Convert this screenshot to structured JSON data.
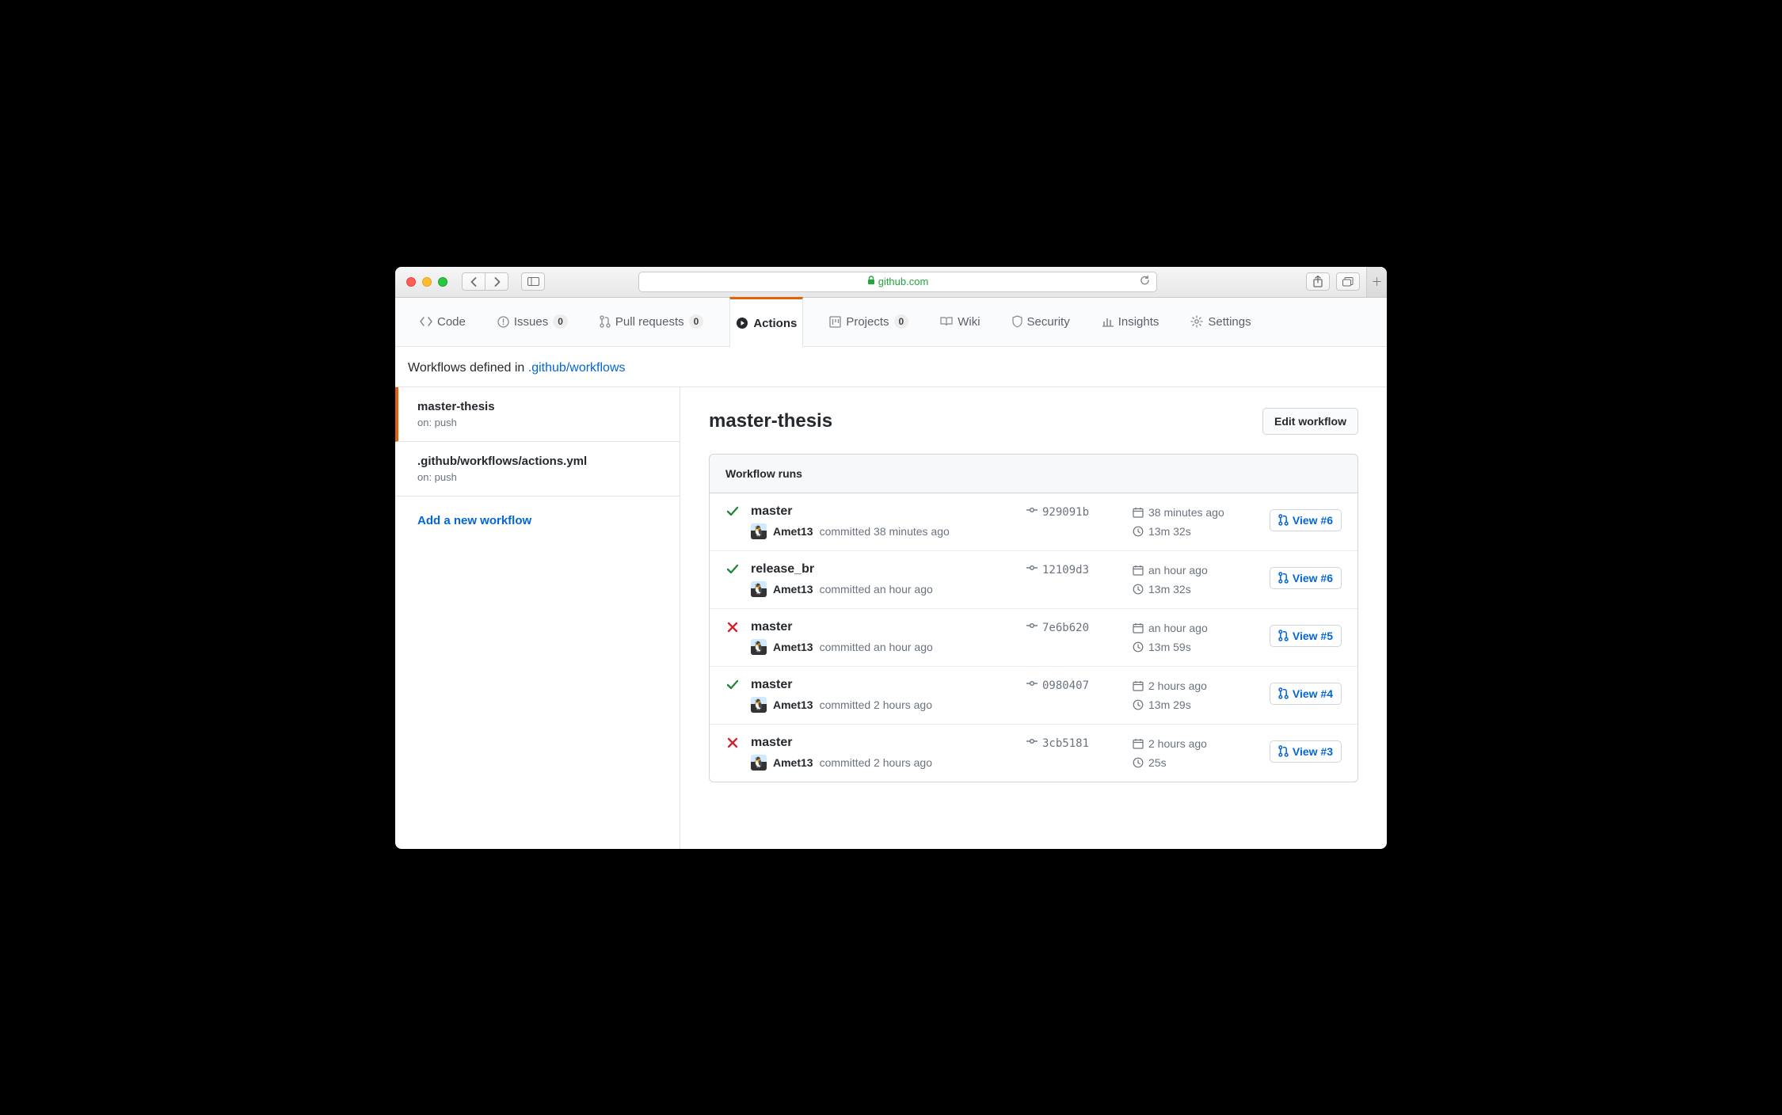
{
  "browser": {
    "domain": "github.com"
  },
  "tabs": {
    "code": "Code",
    "issues": "Issues",
    "issues_count": "0",
    "pulls": "Pull requests",
    "pulls_count": "0",
    "actions": "Actions",
    "projects": "Projects",
    "projects_count": "0",
    "wiki": "Wiki",
    "security": "Security",
    "insights": "Insights",
    "settings": "Settings"
  },
  "subheader": {
    "prefix": "Workflows defined in ",
    "link": ".github/workflows"
  },
  "sidebar": {
    "workflows": [
      {
        "title": "master-thesis",
        "sub": "on: push",
        "active": true
      },
      {
        "title": ".github/workflows/actions.yml",
        "sub": "on: push",
        "active": false
      }
    ],
    "add": "Add a new workflow"
  },
  "content": {
    "title": "master-thesis",
    "edit_btn": "Edit workflow",
    "runs_header": "Workflow runs",
    "view_label": "View",
    "runs": [
      {
        "status": "success",
        "branch": "master",
        "author": "Amet13",
        "committed": "committed 38 minutes ago",
        "hash": "929091b",
        "time_ago": "38 minutes ago",
        "duration": "13m 32s",
        "view_num": "#6"
      },
      {
        "status": "success",
        "branch": "release_br",
        "author": "Amet13",
        "committed": "committed an hour ago",
        "hash": "12109d3",
        "time_ago": "an hour ago",
        "duration": "13m 32s",
        "view_num": "#6"
      },
      {
        "status": "failure",
        "branch": "master",
        "author": "Amet13",
        "committed": "committed an hour ago",
        "hash": "7e6b620",
        "time_ago": "an hour ago",
        "duration": "13m 59s",
        "view_num": "#5"
      },
      {
        "status": "success",
        "branch": "master",
        "author": "Amet13",
        "committed": "committed 2 hours ago",
        "hash": "0980407",
        "time_ago": "2 hours ago",
        "duration": "13m 29s",
        "view_num": "#4"
      },
      {
        "status": "failure",
        "branch": "master",
        "author": "Amet13",
        "committed": "committed 2 hours ago",
        "hash": "3cb5181",
        "time_ago": "2 hours ago",
        "duration": "25s",
        "view_num": "#3"
      }
    ]
  }
}
